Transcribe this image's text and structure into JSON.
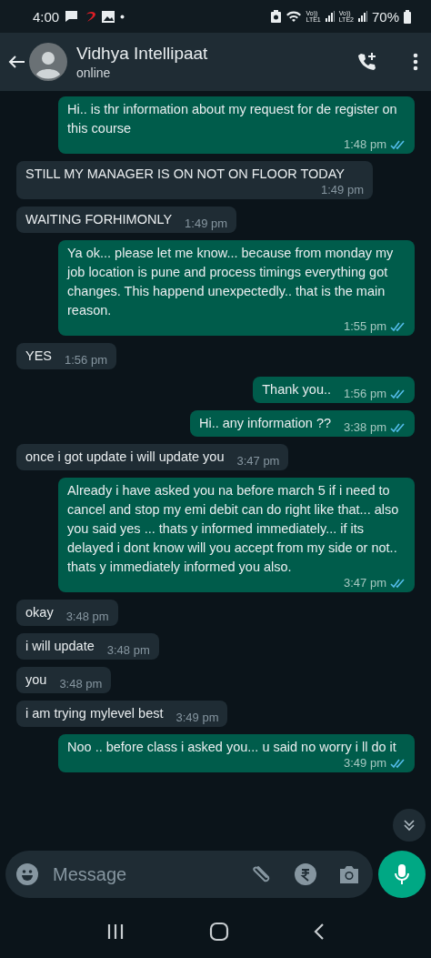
{
  "status_bar": {
    "time": "4:00",
    "sims": [
      {
        "top": "Vo))",
        "bottom": "LTE1"
      },
      {
        "top": "Vo))",
        "bottom": "LTE2"
      }
    ],
    "battery": "70%"
  },
  "header": {
    "name": "Vidhya Intellipaat",
    "status": "online"
  },
  "messages": [
    {
      "kind": "out",
      "text": "Hi.. is thr information about my request for de register on this course",
      "time": "1:48 pm",
      "read": true
    },
    {
      "kind": "in",
      "text": "STILL MY MANAGER IS ON NOT ON FLOOR TODAY",
      "time": "1:49 pm"
    },
    {
      "kind": "in",
      "text": "WAITING FORHIMONLY",
      "time": "1:49 pm"
    },
    {
      "kind": "out",
      "text": "Ya ok... please let me know... because from monday my job location is pune and process timings everything got changes. This happend unexpectedly.. that is the main reason.",
      "time": "1:55 pm",
      "read": true
    },
    {
      "kind": "in",
      "text": "YES",
      "time": "1:56 pm"
    },
    {
      "kind": "out",
      "text": "Thank you..",
      "time": "1:56 pm",
      "read": true
    },
    {
      "kind": "out",
      "text": "Hi.. any information ??",
      "time": "3:38 pm",
      "read": true
    },
    {
      "kind": "in",
      "text": "once i got  update i will update you",
      "time": "3:47 pm"
    },
    {
      "kind": "out",
      "text": "Already i have asked you na before march 5 if i need to cancel and stop my emi debit can do right like that... also you said yes ... thats y informed immediately... if its delayed i dont know will you accept from my side or not.. thats y immediately informed you also.",
      "time": "3:47 pm",
      "read": true
    },
    {
      "kind": "in",
      "text": "okay",
      "time": "3:48 pm"
    },
    {
      "kind": "in",
      "text": "i will update",
      "time": "3:48 pm"
    },
    {
      "kind": "in",
      "text": "you",
      "time": "3:48 pm"
    },
    {
      "kind": "in",
      "text": "i am trying mylevel best",
      "time": "3:49 pm"
    },
    {
      "kind": "out",
      "text": "Noo .. before class i asked you... u said no worry i ll do it",
      "time": "3:49 pm",
      "read": true
    }
  ],
  "composer": {
    "placeholder": "Message"
  }
}
